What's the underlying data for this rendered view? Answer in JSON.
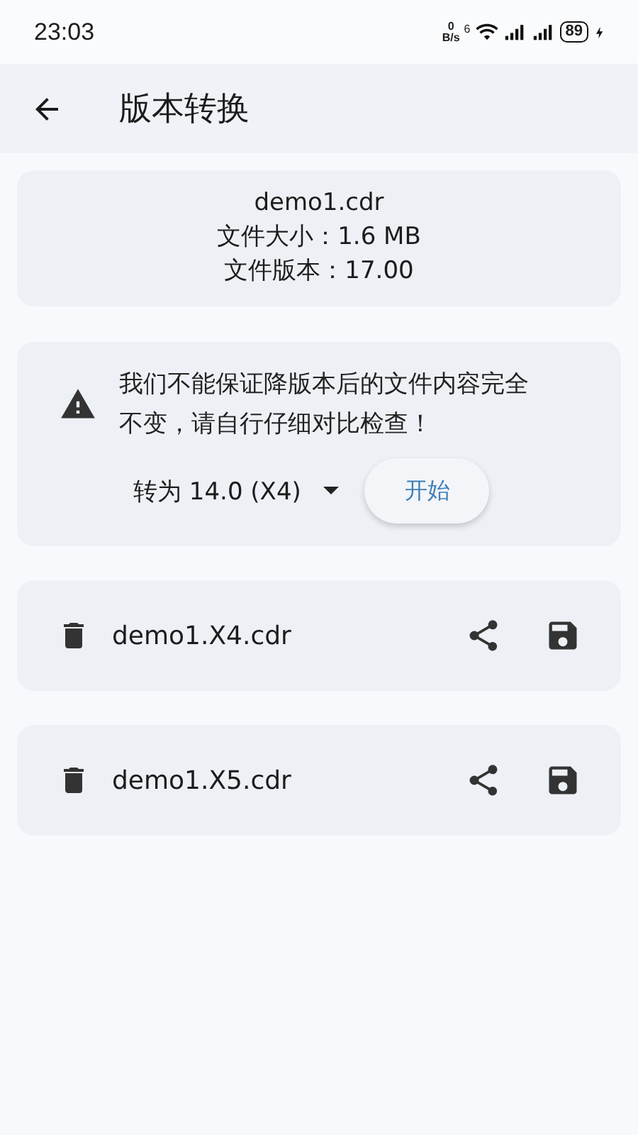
{
  "status_bar": {
    "time": "23:03",
    "net_speed": "0",
    "net_unit": "B/s",
    "wifi_tag": "6",
    "battery": "89"
  },
  "app_bar": {
    "title": "版本转换"
  },
  "file_info": {
    "name": "demo1.cdr",
    "lines": [
      "文件大小：1.6 MB",
      "文件版本：17.00"
    ]
  },
  "convert": {
    "warning": "我们不能保证降版本后的文件内容完全不变，请自行仔细对比检查！",
    "target": "转为 14.0 (X4)",
    "start_button": "开始"
  },
  "outputs": [
    {
      "name": "demo1.X4.cdr"
    },
    {
      "name": "demo1.X5.cdr"
    }
  ]
}
